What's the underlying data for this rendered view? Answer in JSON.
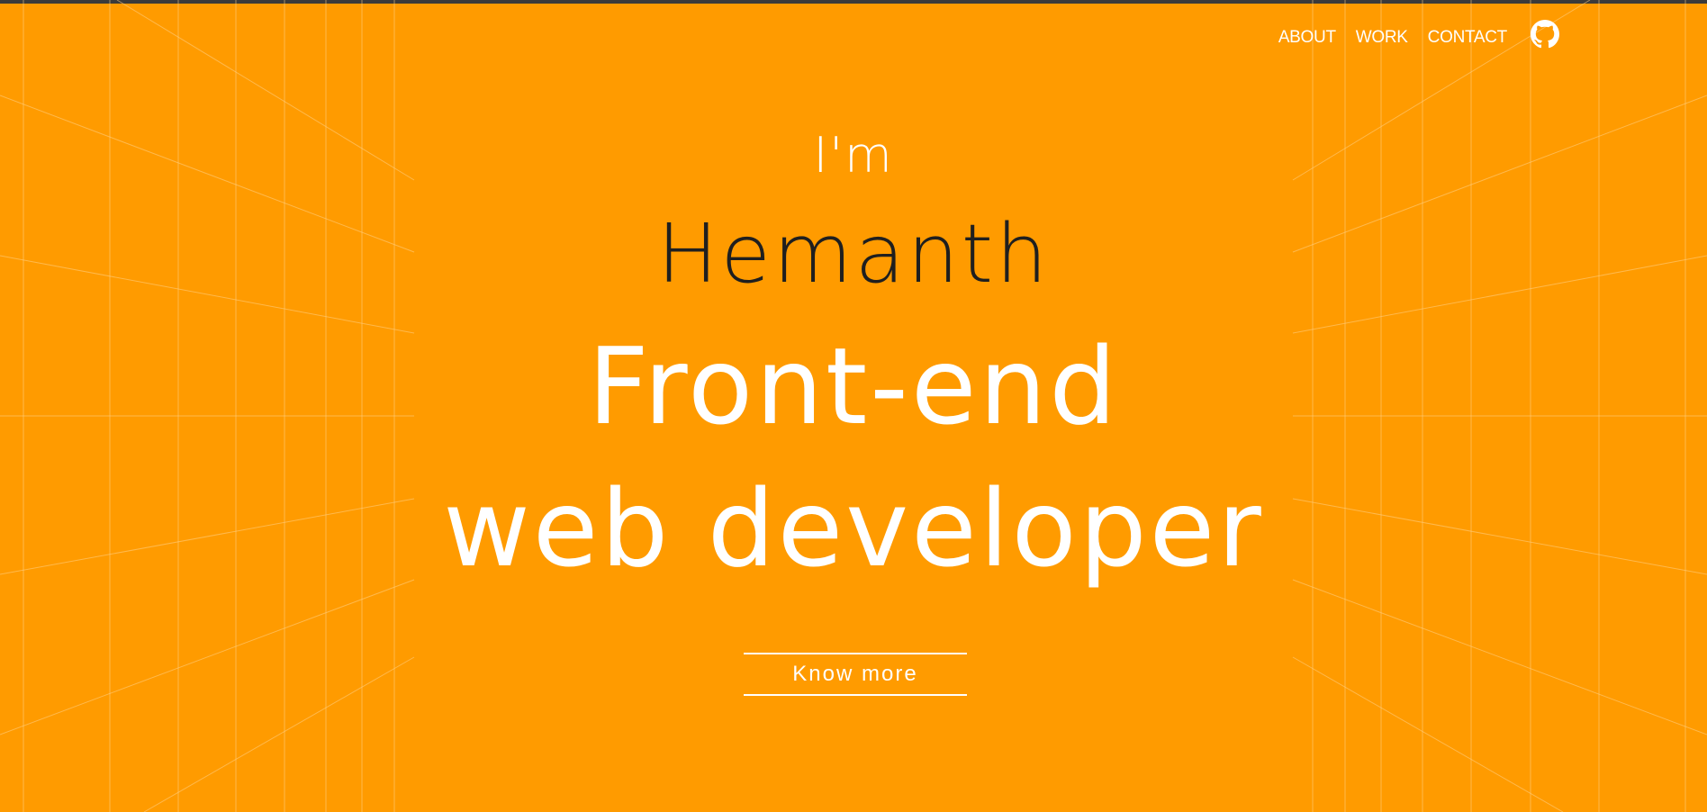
{
  "colors": {
    "background": "#ff9b00",
    "text_light": "#ffffff",
    "text_dark": "#1f1f1f",
    "grid_line": "#ffd28a"
  },
  "nav": {
    "items": [
      {
        "label": "ABOUT"
      },
      {
        "label": "WORK"
      },
      {
        "label": "CONTACT"
      }
    ],
    "github_icon": "github-icon"
  },
  "hero": {
    "intro": "I'm",
    "name": "Hemanth",
    "role_line1": "Front-end",
    "role_line2": "web developer",
    "cta_label": "Know more"
  }
}
